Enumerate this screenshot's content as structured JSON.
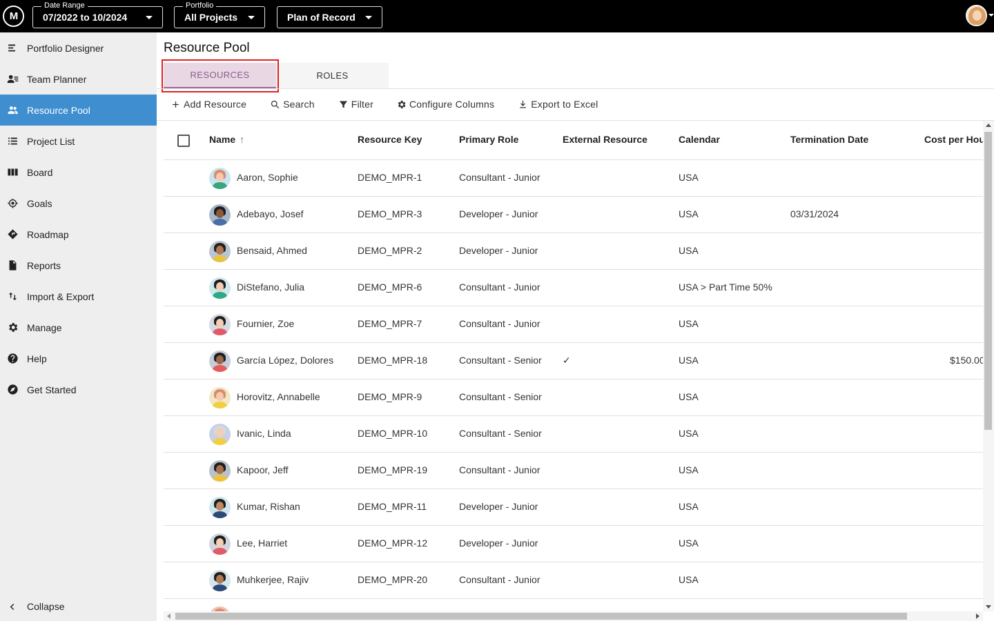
{
  "topbar": {
    "logo_text": "M",
    "date_range": {
      "legend": "Date Range",
      "value": "07/2022 to 10/2024"
    },
    "portfolio": {
      "legend": "Portfolio",
      "value": "All Projects"
    },
    "scenario": {
      "value": "Plan of Record"
    }
  },
  "sidebar": {
    "items": [
      {
        "label": "Portfolio Designer",
        "icon": "portfolio-designer-icon"
      },
      {
        "label": "Team Planner",
        "icon": "team-planner-icon"
      },
      {
        "label": "Resource Pool",
        "icon": "people-icon",
        "active": true
      },
      {
        "label": "Project List",
        "icon": "list-icon"
      },
      {
        "label": "Board",
        "icon": "board-icon"
      },
      {
        "label": "Goals",
        "icon": "target-icon"
      },
      {
        "label": "Roadmap",
        "icon": "roadmap-icon"
      },
      {
        "label": "Reports",
        "icon": "document-icon"
      },
      {
        "label": "Import & Export",
        "icon": "import-export-icon"
      },
      {
        "label": "Manage",
        "icon": "gear-icon"
      },
      {
        "label": "Help",
        "icon": "help-icon"
      },
      {
        "label": "Get Started",
        "icon": "compass-icon"
      }
    ],
    "collapse_label": "Collapse"
  },
  "page": {
    "title": "Resource Pool",
    "tabs": [
      {
        "label": "RESOURCES",
        "active": true
      },
      {
        "label": "ROLES"
      }
    ],
    "toolbar": {
      "add": "Add Resource",
      "search": "Search",
      "filter": "Filter",
      "configure": "Configure Columns",
      "export": "Export to Excel"
    }
  },
  "grid": {
    "columns": [
      "Name",
      "Resource Key",
      "Primary Role",
      "External Resource",
      "Calendar",
      "Termination Date",
      "Cost per Hou"
    ],
    "rows": [
      {
        "name": "Aaron, Sophie",
        "key": "DEMO_MPR-1",
        "role": "Consultant - Junior",
        "external": "",
        "calendar": "USA",
        "termination": "",
        "cost": "",
        "avatar": {
          "bg": "#c9e4f2",
          "hair": "#d98b6a",
          "skin": "#f6c9b0",
          "shirt": "#3aa57a"
        }
      },
      {
        "name": "Adebayo, Josef",
        "key": "DEMO_MPR-3",
        "role": "Developer - Junior",
        "external": "",
        "calendar": "USA",
        "termination": "03/31/2024",
        "cost": "",
        "avatar": {
          "bg": "#a9b8c8",
          "hair": "#1e1e1e",
          "skin": "#8a5a3c",
          "shirt": "#4a6ea8"
        }
      },
      {
        "name": "Bensaid, Ahmed",
        "key": "DEMO_MPR-2",
        "role": "Developer - Junior",
        "external": "",
        "calendar": "USA",
        "termination": "",
        "cost": "",
        "avatar": {
          "bg": "#b8c6d4",
          "hair": "#2a1f1a",
          "skin": "#b07a55",
          "shirt": "#e8c440"
        }
      },
      {
        "name": "DiStefano, Julia",
        "key": "DEMO_MPR-6",
        "role": "Consultant - Junior",
        "external": "",
        "calendar": "USA > Part Time 50%",
        "termination": "",
        "cost": "",
        "avatar": {
          "bg": "#cde9ee",
          "hair": "#1e1e1e",
          "skin": "#f3cdb4",
          "shirt": "#2fa88a"
        }
      },
      {
        "name": "Fournier, Zoe",
        "key": "DEMO_MPR-7",
        "role": "Consultant - Junior",
        "external": "",
        "calendar": "USA",
        "termination": "",
        "cost": "",
        "avatar": {
          "bg": "#d4dbe4",
          "hair": "#1e1e1e",
          "skin": "#f3cdb4",
          "shirt": "#e05a6a"
        }
      },
      {
        "name": "García López, Dolores",
        "key": "DEMO_MPR-18",
        "role": "Consultant - Senior",
        "external": "✓",
        "calendar": "USA",
        "termination": "",
        "cost": "$150.00",
        "avatar": {
          "bg": "#c4cdd8",
          "hair": "#1e1e1e",
          "skin": "#9a6a48",
          "shirt": "#e85a5a"
        }
      },
      {
        "name": "Horovitz, Annabelle",
        "key": "DEMO_MPR-9",
        "role": "Consultant - Senior",
        "external": "",
        "calendar": "USA",
        "termination": "",
        "cost": "",
        "avatar": {
          "bg": "#f1e7c4",
          "hair": "#d98b6a",
          "skin": "#f6c9b0",
          "shirt": "#f0d040"
        }
      },
      {
        "name": "Ivanic, Linda",
        "key": "DEMO_MPR-10",
        "role": "Consultant - Senior",
        "external": "",
        "calendar": "USA",
        "termination": "",
        "cost": "",
        "avatar": {
          "bg": "#c7d0e8",
          "hair": "#d8d8d8",
          "skin": "#f3cdb4",
          "shirt": "#f0d040"
        }
      },
      {
        "name": "Kapoor, Jeff",
        "key": "DEMO_MPR-19",
        "role": "Consultant - Junior",
        "external": "",
        "calendar": "USA",
        "termination": "",
        "cost": "",
        "avatar": {
          "bg": "#b8c2cc",
          "hair": "#1e1e1e",
          "skin": "#a8724c",
          "shirt": "#f0c040"
        }
      },
      {
        "name": "Kumar, Rishan",
        "key": "DEMO_MPR-11",
        "role": "Developer - Junior",
        "external": "",
        "calendar": "USA",
        "termination": "",
        "cost": "",
        "avatar": {
          "bg": "#cfe6ec",
          "hair": "#1e1e1e",
          "skin": "#c08a62",
          "shirt": "#2c4a78"
        }
      },
      {
        "name": "Lee, Harriet",
        "key": "DEMO_MPR-12",
        "role": "Developer - Junior",
        "external": "",
        "calendar": "USA",
        "termination": "",
        "cost": "",
        "avatar": {
          "bg": "#d0d6de",
          "hair": "#1e1e1e",
          "skin": "#f3cdb4",
          "shirt": "#e05a6a"
        }
      },
      {
        "name": "Muhkerjee, Rajiv",
        "key": "DEMO_MPR-20",
        "role": "Consultant - Junior",
        "external": "",
        "calendar": "USA",
        "termination": "",
        "cost": "",
        "avatar": {
          "bg": "#d6e4ec",
          "hair": "#1e1e1e",
          "skin": "#b07a55",
          "shirt": "#2c4a78"
        }
      },
      {
        "name": "",
        "key": "",
        "role": "",
        "external": "",
        "calendar": "",
        "termination": "",
        "cost": "",
        "avatar": {
          "bg": "#f0c0b0",
          "hair": "#d98b6a",
          "skin": "#f6c9b0",
          "shirt": "#e05a6a"
        }
      }
    ]
  }
}
